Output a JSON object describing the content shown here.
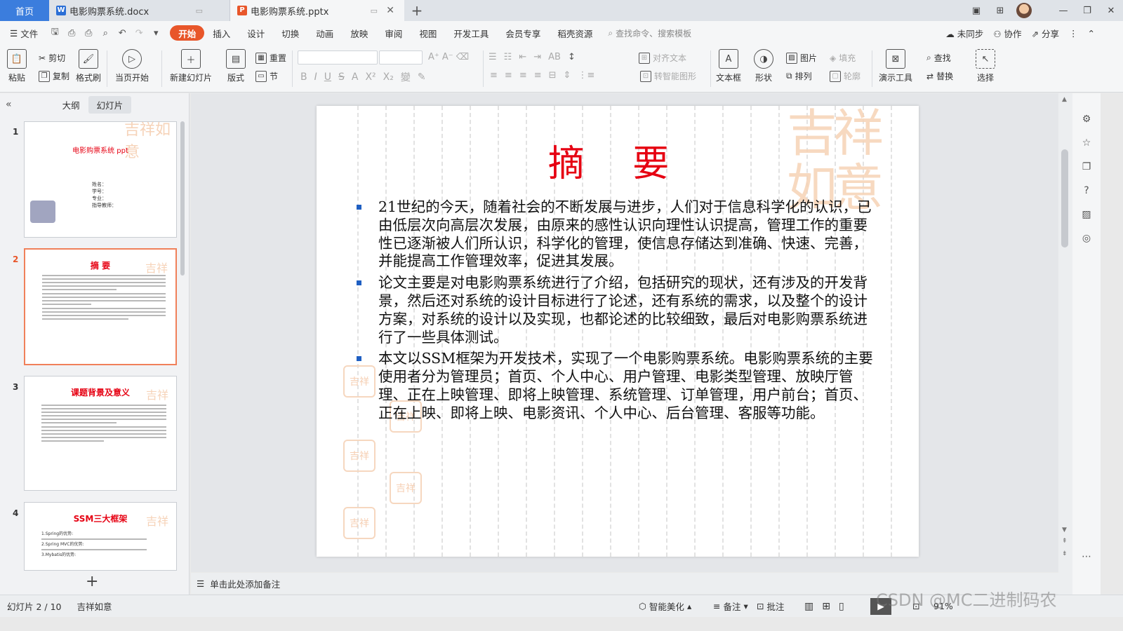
{
  "tabs": {
    "home": "首页",
    "doc": "电影购票系统.docx",
    "ppt": "电影购票系统.pptx"
  },
  "menu": {
    "file": "文件",
    "items": [
      "开始",
      "插入",
      "设计",
      "切换",
      "动画",
      "放映",
      "审阅",
      "视图",
      "开发工具",
      "会员专享",
      "稻壳资源"
    ],
    "search": "查找命令、搜索模板",
    "sync": "未同步",
    "collab": "协作",
    "share": "分享"
  },
  "ribbon": {
    "paste": "粘贴",
    "cut": "剪切",
    "copy": "复制",
    "format_painter": "格式刷",
    "from_current": "当页开始",
    "new_slide": "新建幻灯片",
    "layout": "版式",
    "reset": "重置",
    "section": "节",
    "align_text": "对齐文本",
    "smart_graphic": "转智能图形",
    "textbox": "文本框",
    "shape": "形状",
    "picture": "图片",
    "arrange": "排列",
    "fill": "填充",
    "outline": "轮廓",
    "find": "查找",
    "replace": "替换",
    "presentation_tools": "演示工具",
    "select": "选择"
  },
  "panel": {
    "outline_tab": "大纲",
    "slides_tab": "幻灯片",
    "thumbs": [
      {
        "num": "1",
        "title": "电影购票系统 ppt",
        "fields": [
          "姓名：",
          "学号：",
          "专业：",
          "指导教师："
        ]
      },
      {
        "num": "2",
        "title": "摘  要"
      },
      {
        "num": "3",
        "title": "课题背景及意义"
      },
      {
        "num": "4",
        "title": "SSM三大框架",
        "items": [
          "1.Spring的优势:",
          "2.Spring MVC的优势:",
          "3.Mybatis的优势:"
        ]
      }
    ]
  },
  "slide": {
    "title": "摘  要",
    "bullets": [
      "21世纪的今天，随着社会的不断发展与进步，人们对于信息科学化的认识，已由低层次向高层次发展，由原来的感性认识向理性认识提高，管理工作的重要性已逐渐被人们所认识，科学化的管理，使信息存储达到准确、快速、完善，并能提高工作管理效率，促进其发展。",
      "论文主要是对电影购票系统进行了介绍，包括研究的现状，还有涉及的开发背景，然后还对系统的设计目标进行了论述，还有系统的需求，以及整个的设计方案，对系统的设计以及实现，也都论述的比较细致，最后对电影购票系统进行了一些具体测试。",
      "本文以SSM框架为开发技术，实现了一个电影购票系统。电影购票系统的主要使用者分为管理员；首页、个人中心、用户管理、电影类型管理、放映厅管理、正在上映管理、即将上映管理、系统管理、订单管理，用户前台；首页、正在上映、即将上映、电影资讯、个人中心、后台管理、客服等功能。"
    ],
    "seal_text": "吉祥如意"
  },
  "notes_placeholder": "单击此处添加备注",
  "status": {
    "slide_info": "幻灯片 2 / 10",
    "theme": "吉祥如意",
    "beautify": "智能美化",
    "notes": "备注",
    "comments": "批注",
    "zoom": "91%"
  },
  "watermark": "CSDN @MC二进制码农",
  "colors": {
    "accent": "#e8562a",
    "title_red": "#e60012",
    "bullet_blue": "#1f5fc2",
    "home_tab": "#3b7ddd"
  }
}
